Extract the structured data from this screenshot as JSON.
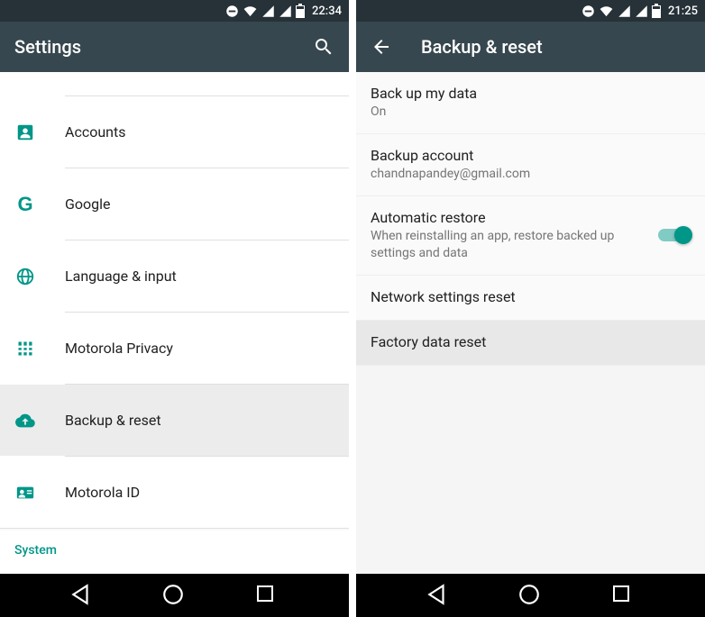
{
  "left": {
    "status_time": "22:34",
    "toolbar_title": "Settings",
    "items": [
      {
        "label": "Accounts",
        "icon": "accounts-icon"
      },
      {
        "label": "Google",
        "icon": "google-icon"
      },
      {
        "label": "Language & input",
        "icon": "globe-icon"
      },
      {
        "label": "Motorola Privacy",
        "icon": "privacy-icon"
      },
      {
        "label": "Backup & reset",
        "icon": "backup-icon",
        "selected": true
      },
      {
        "label": "Motorola ID",
        "icon": "id-icon"
      }
    ],
    "section_label": "System"
  },
  "right": {
    "status_time": "21:25",
    "toolbar_title": "Backup & reset",
    "items": [
      {
        "title": "Back up my data",
        "subtitle": "On"
      },
      {
        "title": "Backup account",
        "subtitle": "chandnapandey@gmail.com"
      },
      {
        "title": "Automatic restore",
        "subtitle": "When reinstalling an app, restore backed up settings and data",
        "toggle": true,
        "toggle_on": true
      },
      {
        "title": "Network settings reset"
      },
      {
        "title": "Factory data reset",
        "selected": true
      }
    ]
  },
  "colors": {
    "accent": "#009688",
    "toolbar": "#37474f"
  }
}
